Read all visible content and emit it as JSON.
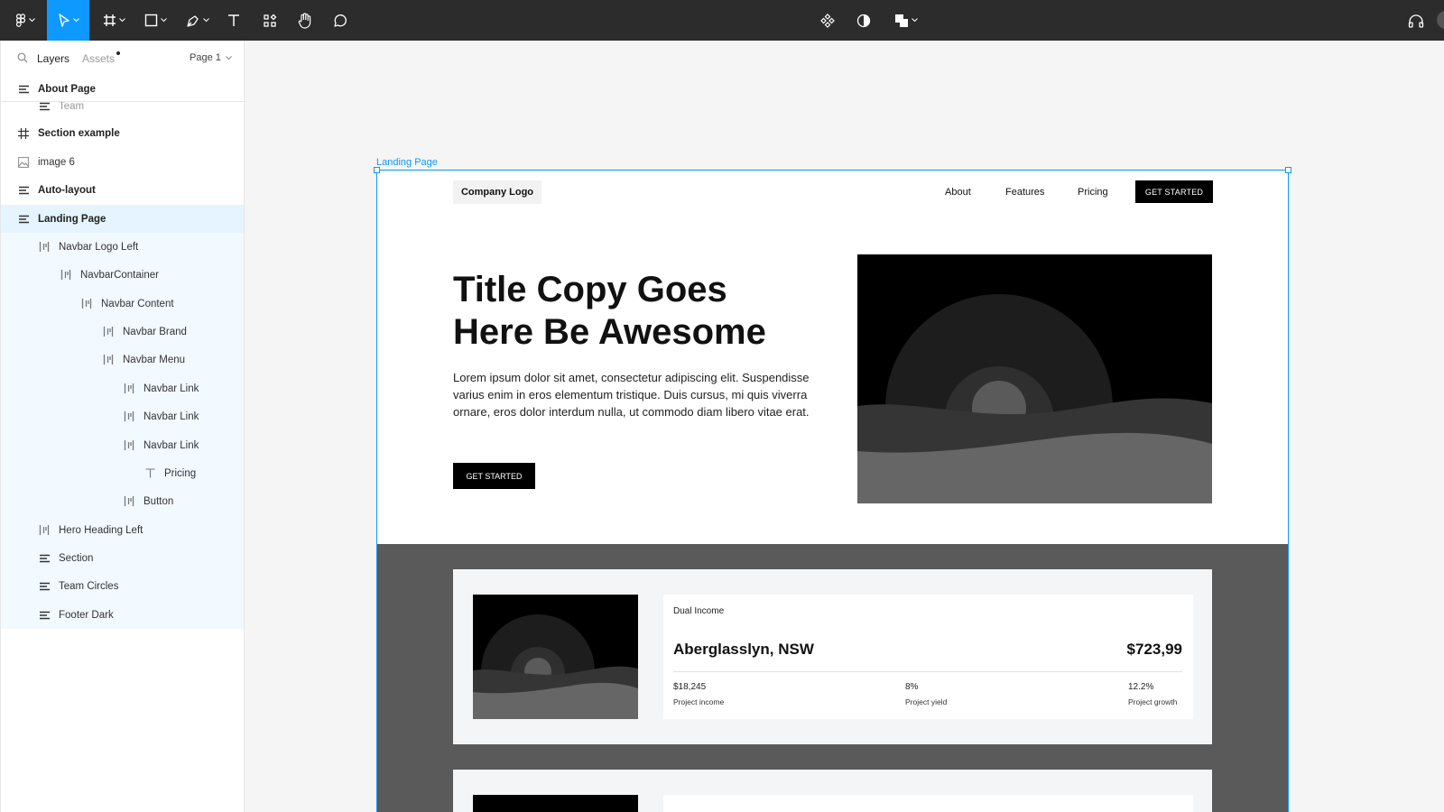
{
  "toolbar": {
    "tools": [
      "main-menu",
      "move",
      "frame",
      "shape",
      "pen",
      "text",
      "resources",
      "hand",
      "comment"
    ],
    "active_tool": "move",
    "right_tools": [
      "component",
      "mask",
      "boolean"
    ],
    "accent": "#0d99ff"
  },
  "sidebar": {
    "tab_layers": "Layers",
    "tab_assets": "Assets",
    "page_selector": "Page 1",
    "layers": [
      {
        "label": "About Page",
        "icon": "autolayout-icon"
      },
      {
        "label": "Team",
        "icon": "autolayout-icon"
      },
      {
        "label": "Section example",
        "icon": "frame-icon"
      },
      {
        "label": "image 6",
        "icon": "image-icon"
      },
      {
        "label": "Auto-layout",
        "icon": "autolayout-icon"
      },
      {
        "label": "Landing Page",
        "icon": "autolayout-icon"
      },
      {
        "label": "Navbar Logo Left",
        "icon": "autolayout-horizontal-icon"
      },
      {
        "label": "NavbarContainer",
        "icon": "autolayout-horizontal-icon"
      },
      {
        "label": "Navbar Content",
        "icon": "autolayout-horizontal-icon"
      },
      {
        "label": "Navbar Brand",
        "icon": "autolayout-horizontal-icon"
      },
      {
        "label": "Navbar Menu",
        "icon": "autolayout-horizontal-icon"
      },
      {
        "label": "Navbar Link",
        "icon": "autolayout-horizontal-icon"
      },
      {
        "label": "Navbar Link",
        "icon": "autolayout-horizontal-icon"
      },
      {
        "label": "Navbar Link",
        "icon": "autolayout-horizontal-icon"
      },
      {
        "label": "Pricing",
        "icon": "text-icon"
      },
      {
        "label": "Button",
        "icon": "autolayout-horizontal-icon"
      },
      {
        "label": "Hero Heading Left",
        "icon": "autolayout-horizontal-icon"
      },
      {
        "label": "Section",
        "icon": "autolayout-icon"
      },
      {
        "label": "Team Circles",
        "icon": "autolayout-icon"
      },
      {
        "label": "Footer Dark",
        "icon": "autolayout-icon"
      }
    ]
  },
  "canvas": {
    "frame_label": "Landing Page",
    "landing": {
      "logo": "Company Logo",
      "nav": [
        "About",
        "Features",
        "Pricing"
      ],
      "nav_cta": "GET STARTED",
      "title": "Title Copy Goes Here Be Awesome",
      "body": "Lorem ipsum dolor sit amet, consectetur adipiscing elit. Suspendisse varius enim in eros elementum tristique. Duis cursus, mi quis viverra ornare, eros dolor interdum nulla, ut commodo diam libero vitae erat.",
      "hero_cta": "GET STARTED",
      "card": {
        "tag": "Dual Income",
        "title": "Aberglasslyn, NSW",
        "price": "$723,99",
        "stats": [
          {
            "value": "$18,245",
            "label": "Project income"
          },
          {
            "value": "8%",
            "label": "Project yield"
          },
          {
            "value": "12.2%",
            "label": "Project growth"
          }
        ]
      }
    }
  }
}
